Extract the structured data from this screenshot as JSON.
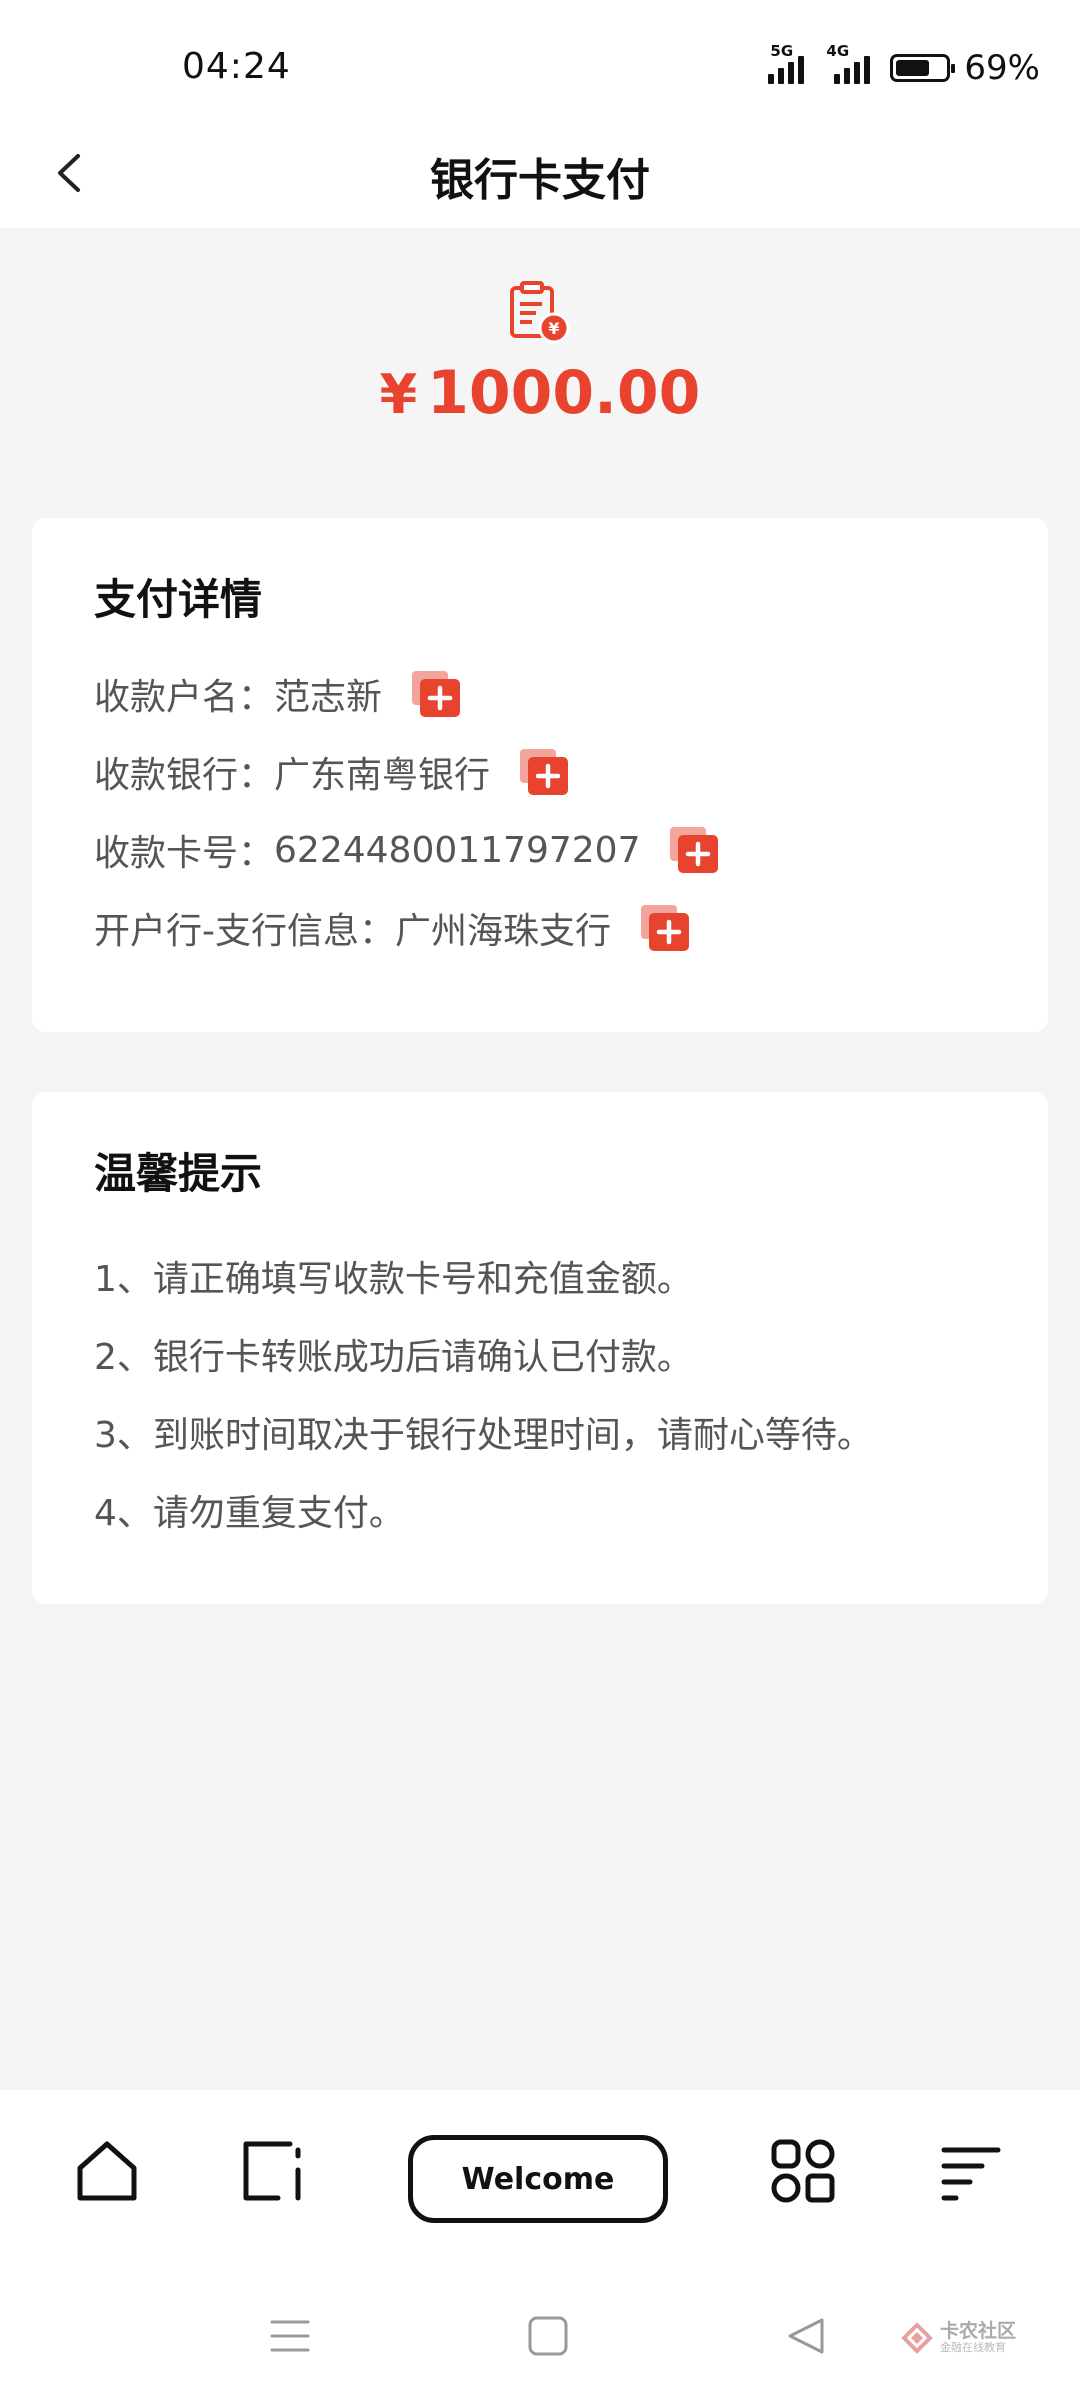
{
  "status_bar": {
    "time": "04:24",
    "signal_1_label": "5G",
    "signal_2_label": "4G",
    "battery_percent": "69%",
    "battery_level": 0.69
  },
  "header": {
    "title": "银行卡支付"
  },
  "amount": {
    "currency": "¥",
    "value": "1000.00"
  },
  "details": {
    "title": "支付详情",
    "rows": [
      {
        "label": "收款户名：",
        "value": "范志新"
      },
      {
        "label": "收款银行：",
        "value": "广东南粤银行"
      },
      {
        "label": "收款卡号：",
        "value": "6224480011797207"
      },
      {
        "label": "开户行-支行信息：",
        "value": "广州海珠支行"
      }
    ]
  },
  "tips": {
    "title": "温馨提示",
    "lines": [
      "1、请正确填写收款卡号和充值金额。",
      "2、银行卡转账成功后请确认已付款。",
      "3、到账时间取决于银行处理时间，请耐心等待。",
      "4、请勿重复支付。"
    ]
  },
  "browser_bar": {
    "center_label": "Welcome",
    "icons": [
      "home-icon",
      "tabs-icon",
      "apps-icon",
      "menu-icon"
    ]
  },
  "system_nav": {
    "icons": [
      "recents-icon",
      "home-square-icon",
      "back-triangle-icon"
    ]
  },
  "watermark": {
    "main": "卡农社区",
    "sub": "金融在线教育"
  },
  "colors": {
    "accent": "#e8432e",
    "background": "#f5f5f5",
    "card": "#ffffff"
  }
}
